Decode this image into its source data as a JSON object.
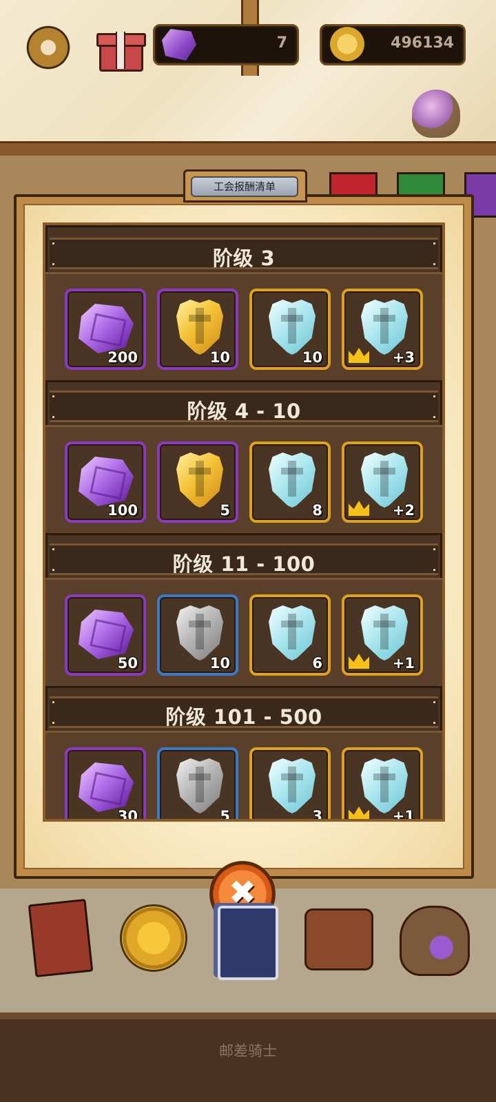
{
  "hud": {
    "gems": "7",
    "gold": "496134"
  },
  "panel": {
    "tab_label": "工会报酬清单",
    "close_label": "✖"
  },
  "tiers": [
    {
      "title": "阶级 3",
      "rewards": [
        {
          "icon": "purple-gem-icon",
          "count": "200",
          "frame": "purple",
          "crown": false
        },
        {
          "icon": "gold-shield-icon",
          "count": "10",
          "frame": "purple",
          "crown": false
        },
        {
          "icon": "ice-shield-icon",
          "count": "10",
          "frame": "orange",
          "crown": false
        },
        {
          "icon": "ice-shield-icon",
          "count": "+3",
          "frame": "orange",
          "crown": true
        }
      ]
    },
    {
      "title": "阶级 4 - 10",
      "rewards": [
        {
          "icon": "purple-gem-icon",
          "count": "100",
          "frame": "purple",
          "crown": false
        },
        {
          "icon": "gold-shield-icon",
          "count": "5",
          "frame": "purple",
          "crown": false
        },
        {
          "icon": "ice-shield-icon",
          "count": "8",
          "frame": "orange",
          "crown": false
        },
        {
          "icon": "ice-shield-icon",
          "count": "+2",
          "frame": "orange",
          "crown": true
        }
      ]
    },
    {
      "title": "阶级 11 - 100",
      "rewards": [
        {
          "icon": "purple-gem-icon",
          "count": "50",
          "frame": "purple",
          "crown": false
        },
        {
          "icon": "steel-shield-icon",
          "count": "10",
          "frame": "blue",
          "crown": false
        },
        {
          "icon": "ice-shield-icon",
          "count": "6",
          "frame": "orange",
          "crown": false
        },
        {
          "icon": "ice-shield-icon",
          "count": "+1",
          "frame": "orange",
          "crown": true
        }
      ]
    },
    {
      "title": "阶级 101 - 500",
      "rewards": [
        {
          "icon": "purple-gem-icon",
          "count": "30",
          "frame": "purple",
          "crown": false
        },
        {
          "icon": "steel-shield-icon",
          "count": "5",
          "frame": "blue",
          "crown": false
        },
        {
          "icon": "ice-shield-icon",
          "count": "3",
          "frame": "orange",
          "crown": false
        },
        {
          "icon": "ice-shield-icon",
          "count": "+1",
          "frame": "orange",
          "crown": true
        }
      ]
    }
  ],
  "nav": {
    "items": [
      "book-icon",
      "star-coin-icon",
      "card-deck-icon",
      "adventure-bag-icon",
      "loot-bag-icon"
    ]
  },
  "footer": {
    "title": "邮差骑士"
  },
  "colors": {
    "frame_purple": "#8a3ac0",
    "frame_orange": "#e0a020",
    "frame_blue": "#3a7ac8"
  }
}
